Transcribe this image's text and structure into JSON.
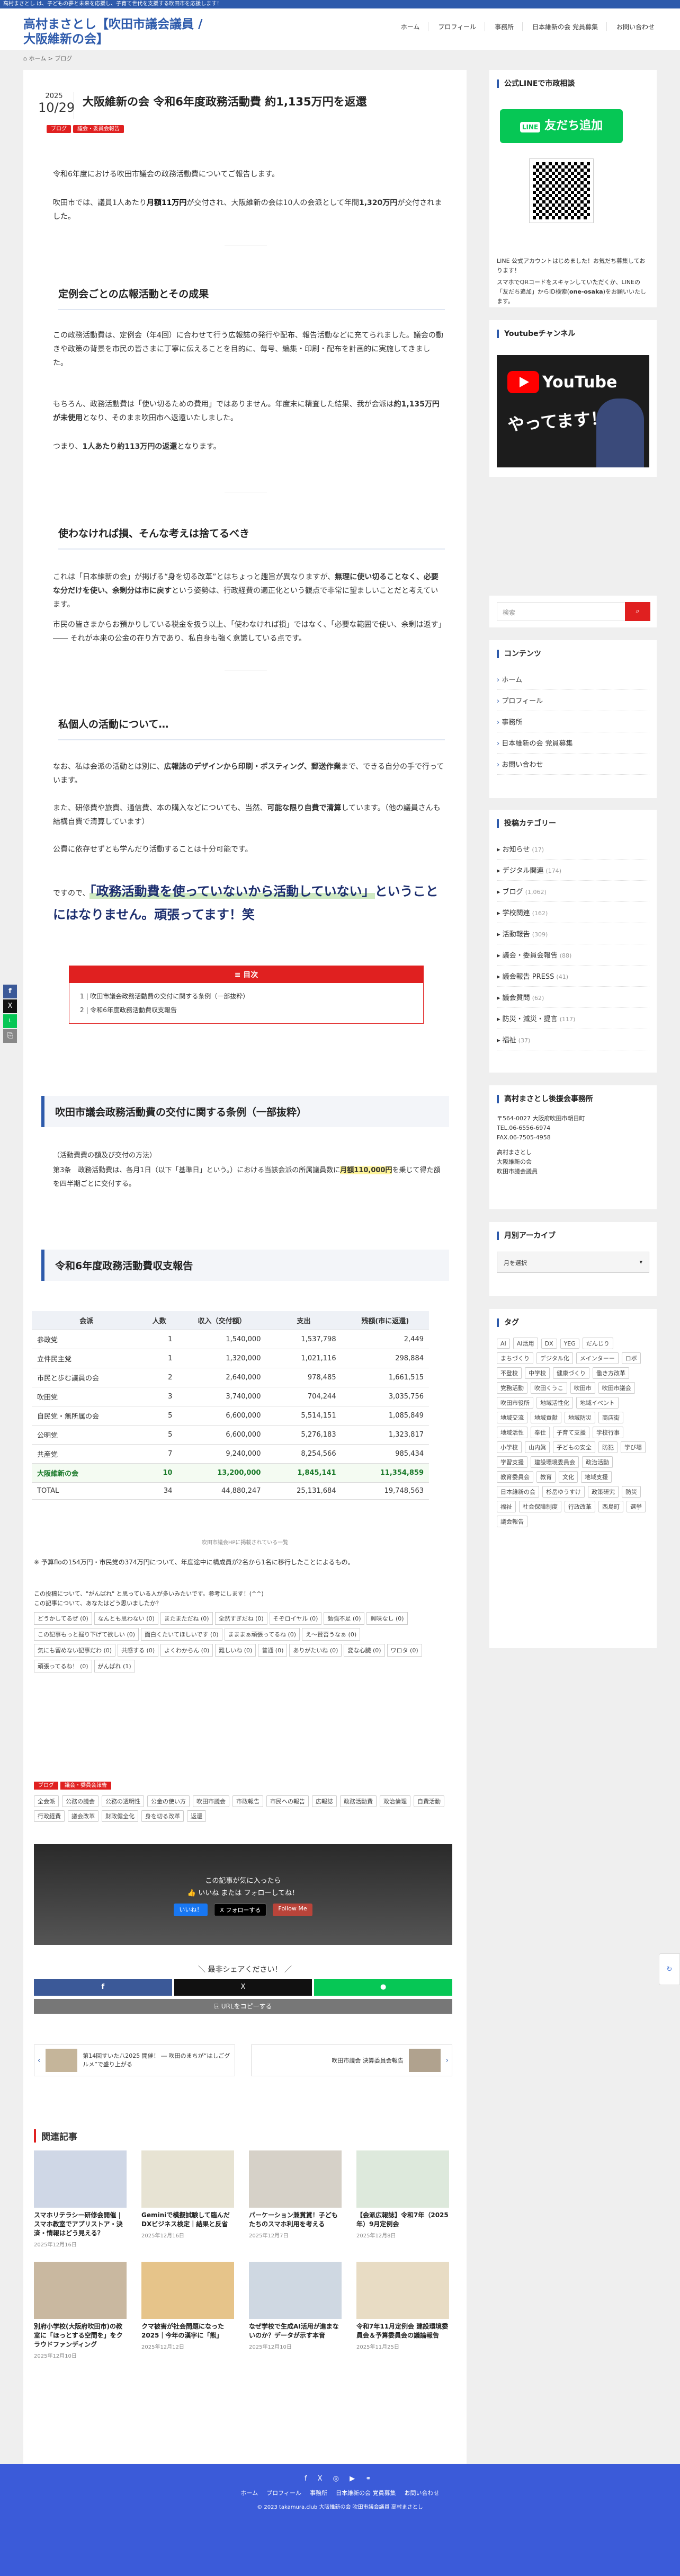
{
  "topbar": {
    "text": "高村まさとし は、子どもの夢と未来を応援し、子育て世代を支援する吹田市を応援します！"
  },
  "site": {
    "title": "高村まさとし【吹田市議会議員 / 大阪維新の会】"
  },
  "nav": [
    "ホーム",
    "プロフィール",
    "事務所",
    "日本維新の会 党員募集",
    "お問い合わせ"
  ],
  "breadcrumb": {
    "home": "ホーム",
    "sep": ">",
    "current": "ブログ"
  },
  "post": {
    "year": "2025",
    "date": "10/29",
    "title": "大阪維新の会 令和6年度政務活動費 約1,135万円を返還",
    "cats": [
      "ブログ",
      "議会・委員会報告"
    ],
    "p1": "令和6年度における吹田市議会の政務活動費についてご報告します。",
    "p2a": "吹田市では、議員1人あたり",
    "p2b": "月額11万円",
    "p2c": "が交付され、大阪維新の会は10人の会派として年間",
    "p2d": "1,320万円",
    "p2e": "が交付されました。",
    "h_pr": "定例会ごとの広報活動とその成果",
    "p3": "この政務活動費は、定例会（年4回）に合わせて行う広報誌の発行や配布、報告活動などに充てられました。議会の動きや政策の背景を市民の皆さまに丁寧に伝えることを目的に、毎号、編集・印刷・配布を計画的に実施してきました。",
    "p4a": "もちろん、政務活動費は「使い切るための費用」ではありません。年度末に精査した結果、我が会派は",
    "p4b": "約1,135万円が未使用",
    "p4c": "となり、そのまま吹田市へ返還いたしました。",
    "p5a": "つまり、",
    "p5b": "1人あたり約113万円の返還",
    "p5c": "となります。",
    "h_waste": "使わなければ損、そんな考えは捨てるべき",
    "p6a": "これは「日本維新の会」が掲げる“身を切る改革”とはちょっと趣旨が異なりますが、",
    "p6b": "無理に使い切ることなく、必要な分だけを使い、余剰分は市に戻す",
    "p6c": "という姿勢は、行政経費の適正化という観点で非常に望ましいことだと考えています。",
    "p7": "市民の皆さまからお預かりしている税金を扱う以上、「使わなければ損」ではなく、「必要な範囲で使い、余剰は返す」―― それが本来の公金の在り方であり、私自身も強く意識している点です。",
    "h_private": "私個人の活動について…",
    "p8a": "なお、私は会派の活動とは別に、",
    "p8b": "広報誌のデザインから印刷・ポスティング、郵送作業",
    "p8c": "まで、できる自分の手で行っています。",
    "p9a": "また、研修費や旅費、通信費、本の購入などについても、当然、",
    "p9b": "可能な限り自費で清算",
    "p9c": "しています。（他の議員さんも結構自費で清算しています）",
    "p10": "公費に依存せずとも学んだり活動することは十分可能です。",
    "quote_a": "ですので、",
    "quote_b": "「政務活動費を使っていないから活動していない」",
    "quote_c": "ということにはなりません。頑張ってます！笑",
    "toc_title": "目次",
    "toc": [
      "1 | 吹田市議会政務活動費の交付に関する条例（一部抜粋）",
      "2 | 令和6年度政務活動費収支報告"
    ],
    "h_ord": "吹田市議会政務活動費の交付に関する条例（一部抜粋）",
    "ord1": "（活動費費の額及び交付の方法）",
    "ord2a": "第3条　政務活動費は、各月1日（以下「基準日」という。）における当該会派の所属議員数に",
    "ord2b": "月額110,000円",
    "ord2c": "を乗じて得た額を四半期ごとに交付する。",
    "h_report": "令和6年度政務活動費収支報告",
    "table": {
      "headers": [
        "会派",
        "人数",
        "収入（交付額）",
        "支出",
        "残額(市に返還)"
      ],
      "rows": [
        [
          "参政党",
          "1",
          "1,540,000",
          "1,537,798",
          "2,449"
        ],
        [
          "立件民主党",
          "1",
          "1,320,000",
          "1,021,116",
          "298,884"
        ],
        [
          "市民と歩む議員の会",
          "2",
          "2,640,000",
          "978,485",
          "1,661,515"
        ],
        [
          "吹田党",
          "3",
          "3,740,000",
          "704,244",
          "3,035,756"
        ],
        [
          "自民党・無所属の会",
          "5",
          "6,600,000",
          "5,514,151",
          "1,085,849"
        ],
        [
          "公明党",
          "5",
          "6,600,000",
          "5,276,183",
          "1,323,817"
        ],
        [
          "共産党",
          "7",
          "9,240,000",
          "8,254,566",
          "985,434"
        ],
        [
          "大阪維新の会",
          "10",
          "13,200,000",
          "1,845,141",
          "11,354,859"
        ],
        [
          "TOTAL",
          "34",
          "44,880,247",
          "25,131,684",
          "19,748,563"
        ]
      ],
      "caption": "吹田市議会HPに掲載されている一覧"
    },
    "note": "※ 予算floの154万円・市民党の374万円について、年度途中に構成員が2名から1名に移行したことによるもの。",
    "q1": "この投稿について、\"がんばれ\" と思っている人が多いみたいです。参考にします！(^^)",
    "q2": "この記事について、あなたはどう思いましたか？",
    "reactions": [
      "どうかしてるぜ (0)",
      "なんとも思わない (0)",
      "またまただね (0)",
      "全然すぎだね (0)",
      "そぞロイヤル (0)",
      "勉強不足 (0)",
      "興味なし (0)",
      "この記事もっと掘り下げて欲しい (0)",
      "面白くたいてほしいです (0)",
      "まままぁ頑張ってるね (0)",
      "え～賛否うなぁ (0)",
      "気にも留めない記事だわ (0)",
      "共感する (0)",
      "よくわからん (0)",
      "難しいね (0)",
      "普通 (0)",
      "ありがたいね (0)",
      "変な心臓 (0)",
      "ワロタ (0)",
      "頑張ってるね！ (0)",
      "がんばれ (1)"
    ],
    "footer_cats": [
      "ブログ",
      "議会・委員会報告"
    ],
    "tags": [
      "全会派",
      "公務の議会",
      "公務の透明性",
      "公金の使い方",
      "吹田市議会",
      "市政報告",
      "市民への報告",
      "広報誌",
      "政務活動費",
      "政治倫理",
      "自費活動",
      "行政経費",
      "議会改革",
      "財政健全化",
      "身を切る改革",
      "返還"
    ],
    "like_title": "この記事が気に入ったら",
    "like_sub": "いいね または フォローしてね！",
    "like_btn": "いいね！",
    "follow_btn": "フォローする",
    "feedly_btn": "Follow Me",
    "share_title": "＼ 最非シェアください！ ／",
    "url_copy": "URLをコピーする",
    "prev_title": "第14回すいた八2025 開催！ ― 吹田のまちが“はしごグルメ”で盛り上がる",
    "next_title": "吹田市議会 決算委員会報告",
    "related_title": "関連記事",
    "related": [
      {
        "t": "スマホリテラシー研修会開催 | スマホ教室でアプリストア・決済・情報はどう見える？",
        "d": "2025年12月16日"
      },
      {
        "t": "Geminiで模擬試験して臨んだDXビジネス検定｜結果と反省",
        "d": "2025年12月16日"
      },
      {
        "t": "パーケーション兼賞賞！子どもたちのスマホ利用を考える",
        "d": "2025年12月7日"
      },
      {
        "t": "【会派広報誌】令和7年（2025年）9月定例会",
        "d": "2025年12月8日"
      },
      {
        "t": "別府小学校(大阪府吹田市)の教室に「ほっとする空間を」をクラウドファンディング",
        "d": "2025年12月10日"
      },
      {
        "t": "クマ被害が社会問題になった2025｜今年の漢字に「熊」",
        "d": "2025年12月12日"
      },
      {
        "t": "なぜ学校で生成AI活用が進まないのか？データが示す本音",
        "d": "2025年12月10日"
      },
      {
        "t": "令和7年11月定例会 建設環境委員会＆予算委員会の議論報告",
        "d": "2025年11月25日"
      }
    ]
  },
  "sidebar": {
    "line_title": "公式LINEで市政相談",
    "line_btn": "友だち追加",
    "line_text": "LINE 公式アカウントはじめました！お気だち募集しております！",
    "line_text2a": "スマホでQRコードをスキャンしていただくか、LINEの「友だち追加」からID検索(",
    "line_id": "one-osaka",
    "line_text2b": ")をお願いいたします。",
    "yt_title": "Youtubeチャンネル",
    "yt_banner": "YouTube",
    "yt_banner2": "やってます！",
    "search_placeholder": "検索",
    "contents_title": "コンテンツ",
    "contents": [
      "ホーム",
      "プロフィール",
      "事務所",
      "日本維新の会 党員募集",
      "お問い合わせ"
    ],
    "cats_title": "投稿カテゴリー",
    "cats": [
      [
        "お知らせ",
        "(17)"
      ],
      [
        "デジタル関連",
        "(174)"
      ],
      [
        "ブログ",
        "(1,062)"
      ],
      [
        "学校関連",
        "(162)"
      ],
      [
        "活動報告",
        "(309)"
      ],
      [
        "議会・委員会報告",
        "(88)"
      ],
      [
        "議会報告 PRESS",
        "(41)"
      ],
      [
        "議会質問",
        "(62)"
      ],
      [
        "防災・減災・提言",
        "(117)"
      ],
      [
        "福祉",
        "(37)"
      ]
    ],
    "office_title": "高村まさとし後援会事務所",
    "office": [
      "〒564-0027 大阪府吹田市朝日町",
      "TEL.06-6556-6974",
      "FAX.06-7505-4958",
      "",
      "高村まさとし",
      "大阪維新の会",
      "吹田市議会議員"
    ],
    "archive_title": "月別アーカイブ",
    "archive_select": "月を選択",
    "tags_title": "タグ",
    "tags": [
      "AI",
      "AI活用",
      "DX",
      "YEG",
      "だんじり",
      "まちづくり",
      "デジタル化",
      "メインターー",
      "ロボ",
      "不登校",
      "中学校",
      "健康づくり",
      "働き方改革",
      "党務活動",
      "吹田くうこ",
      "吹田市",
      "吹田市議会",
      "吹田市役所",
      "地域活性化",
      "地域イベント",
      "地域交流",
      "地域貢献",
      "地域防災",
      "商店街",
      "地域活性",
      "奉仕",
      "子育て支援",
      "学校行事",
      "小学校",
      "山内眞",
      "子どもの安全",
      "防犯",
      "学び場",
      "学習支援",
      "建設環境委員会",
      "政治活動",
      "教育委員会",
      "教育",
      "文化",
      "地域支援",
      "日本維新の会",
      "杉岳ゆうすけ",
      "政策研究",
      "防災",
      "福祉",
      "社会保障制度",
      "行政改革",
      "西島町",
      "選挙",
      "議会報告"
    ]
  },
  "footer": {
    "links": [
      "ホーム",
      "プロフィール",
      "事務所",
      "日本維新の会 党員募集",
      "お問い合わせ"
    ],
    "copy": "© 2023 takamura.club 大阪維新の会 吹田市議会議員 高村まさとし"
  }
}
